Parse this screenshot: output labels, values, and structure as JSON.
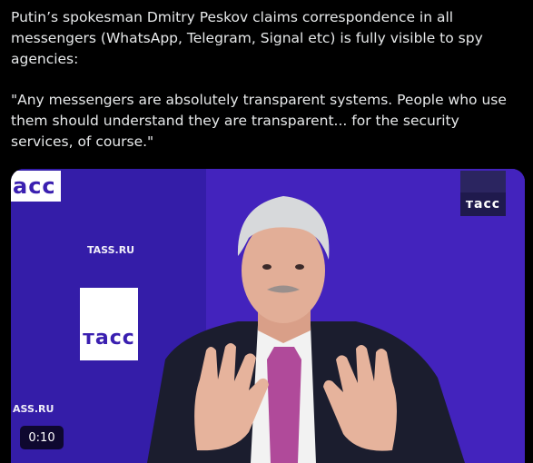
{
  "tweet": {
    "paragraph_1": "Putin’s spokesman Dmitry Peskov claims correspondence in all messengers (WhatsApp, Telegram, Signal etc) is fully visible to spy agencies:",
    "paragraph_2": "\"Any messengers are absolutely transparent systems. People who use them should understand they are transparent... for the security services, of course.\""
  },
  "media": {
    "logo_top_left": "acc",
    "logo_center": "тасс",
    "logo_top_right": "тасс",
    "url_one": "TASS.RU",
    "url_two": "ASS.RU",
    "duration": "0:10",
    "colors": {
      "backdrop": "#3a1fb0",
      "suit": "#1b1d2e",
      "tie": "#b04a9a",
      "shirt": "#f2f2f2",
      "skin": "#e2ae97",
      "hair": "#d7d9db"
    }
  }
}
